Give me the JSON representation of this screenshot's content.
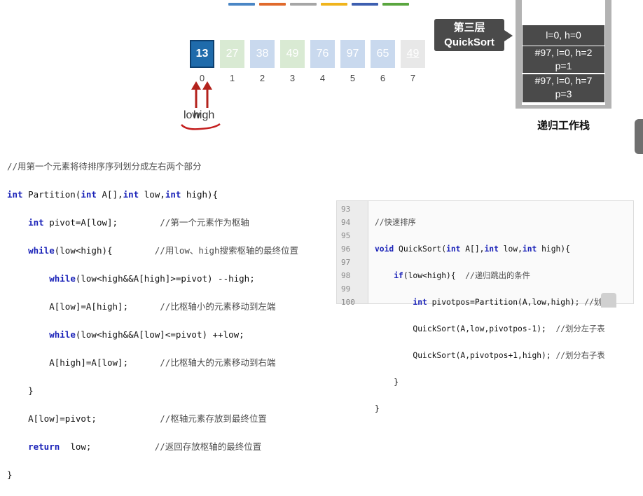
{
  "top_strip_colors": [
    "#4a86c5",
    "#e06a2c",
    "#a6a6a6",
    "#f0b41c",
    "#3d5fb0",
    "#5aa63f"
  ],
  "array": {
    "values": [
      "13",
      "27",
      "38",
      "49",
      "76",
      "97",
      "65",
      "49"
    ],
    "indices": [
      "0",
      "1",
      "2",
      "3",
      "4",
      "5",
      "6",
      "7"
    ],
    "cell_colors": [
      "#1f6bab",
      "#d9ead3",
      "#c9d9ee",
      "#d9ead3",
      "#c9d9ee",
      "#c9d9ee",
      "#c9d9ee",
      "#e8e8e8"
    ]
  },
  "pointers": {
    "overlap_label_a": "low",
    "overlap_label_b": "high",
    "arrow_color": "#b3221c",
    "underline_color": "#c41f1f"
  },
  "callout": {
    "line1": "第三层",
    "line2": "QuickSort"
  },
  "stack": {
    "frames": [
      {
        "line1": "l=0, h=0",
        "line2": ""
      },
      {
        "line1": "#97, l=0, h=2",
        "line2": "p=1"
      },
      {
        "line1": "#97, l=0, h=7",
        "line2": "p=3"
      }
    ],
    "label": "递归工作栈"
  },
  "partition_code": {
    "comment": "//用第一个元素将待排序序列划分成左右两个部分",
    "l1_kw": "int",
    "l1_a": " Partition(",
    "l1_kw2": "int",
    "l1_b": " A[],",
    "l1_kw3": "int",
    "l1_c": " low,",
    "l1_kw4": "int",
    "l1_d": " high){",
    "l2_kw": "int",
    "l2_code": " pivot=A[low];",
    "l2_cm": "//第一个元素作为枢轴",
    "l3_kw": "while",
    "l3_code": "(low<high){",
    "l3_cm": "//用low、high搜索枢轴的最终位置",
    "l4_kw": "while",
    "l4_code": "(low<high&&A[high]>=pivot) --high;",
    "l5_code": "A[low]=A[high];",
    "l5_cm": "//比枢轴小的元素移动到左端",
    "l6_kw": "while",
    "l6_code": "(low<high&&A[low]<=pivot) ++low;",
    "l7_code": "A[high]=A[low];",
    "l7_cm": "//比枢轴大的元素移动到右端",
    "l8_code": "}",
    "l9_code": "A[low]=pivot;",
    "l9_cm": "//枢轴元素存放到最终位置",
    "l10_kw": "return",
    "l10_code": "  low;",
    "l10_cm": "//返回存放枢轴的最终位置",
    "l11_code": "}"
  },
  "quicksort_code": {
    "line_numbers": [
      "93",
      "94",
      "95",
      "96",
      "97",
      "98",
      "99",
      "100"
    ],
    "l93": "//快速排序",
    "l94_kw": "void",
    "l94_a": " QuickSort(",
    "l94_kw2": "int",
    "l94_b": " A[],",
    "l94_kw3": "int",
    "l94_c": " low,",
    "l94_kw4": "int",
    "l94_d": " high){",
    "l95_kw": "if",
    "l95_code": "(low<high){",
    "l95_cm": "  //递归跳出的条件",
    "l96_kw": "int",
    "l96_code": " pivotpos=Partition(A,low,high);",
    "l96_cm": " //划分",
    "l97_code": "QuickSort(A,low,pivotpos-1);",
    "l97_cm": "  //划分左子表",
    "l98_code": "QuickSort(A,pivotpos+1,high);",
    "l98_cm": " //划分右子表",
    "l99_code": "}",
    "l100_code": "}"
  }
}
